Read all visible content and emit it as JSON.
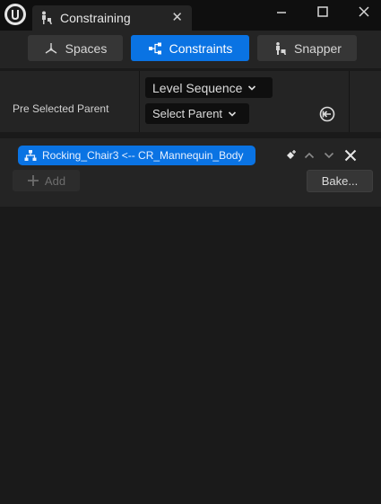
{
  "window": {
    "tab_title": "Constraining",
    "tab_close": "✕"
  },
  "modes": {
    "spaces_label": "Spaces",
    "constraints_label": "Constraints",
    "snapper_label": "Snapper",
    "active": "Constraints"
  },
  "parent": {
    "label": "Pre Selected Parent",
    "sequence_dropdown": "Level Sequence",
    "parent_dropdown": "Select Parent"
  },
  "constraints": {
    "items": [
      {
        "label": "Rocking_Chair3 <-- CR_Mannequin_Body"
      }
    ],
    "add_label": "Add",
    "bake_label": "Bake..."
  },
  "colors": {
    "accent": "#0a73e3",
    "panel": "#242424",
    "background": "#1a1a1a"
  }
}
